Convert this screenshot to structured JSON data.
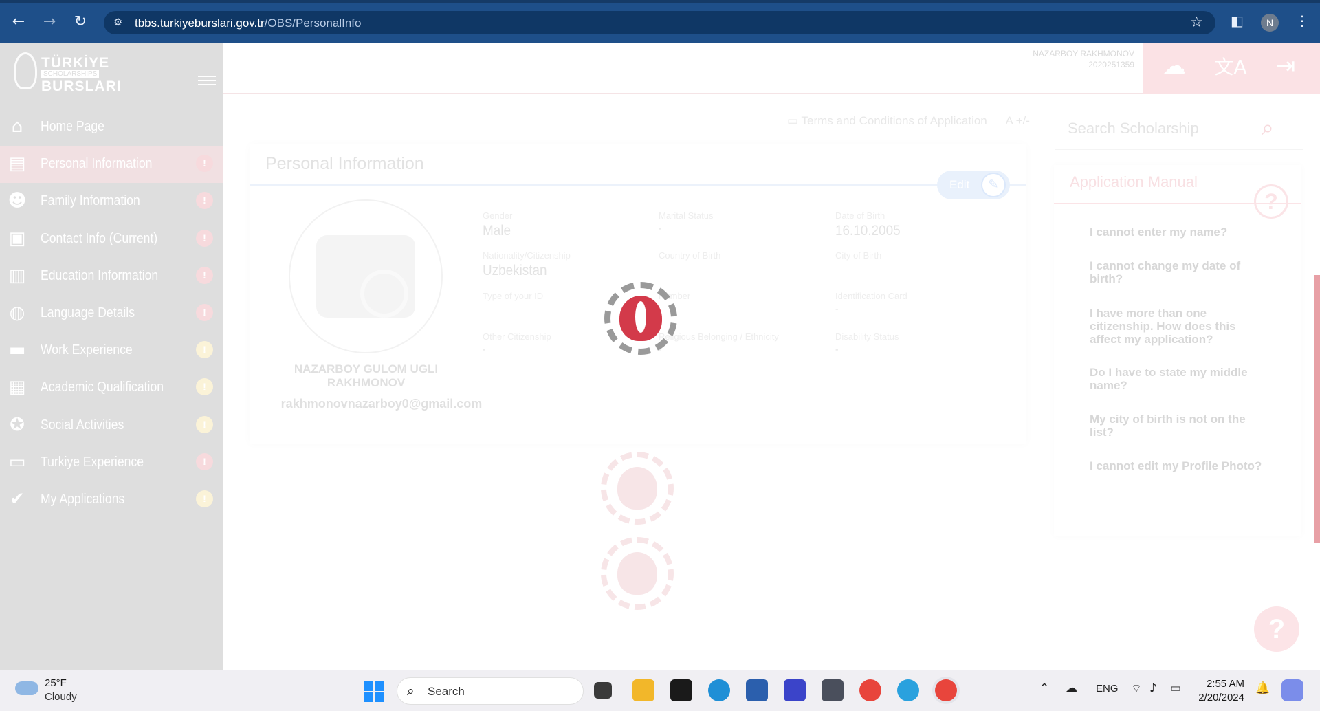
{
  "browser": {
    "url_host": "tbbs.turkiyeburslari.gov.tr",
    "url_path": "/OBS/PersonalInfo",
    "profile_initial": "N"
  },
  "logo": {
    "line1": "TÜRKİYE",
    "line2": "SCHOLARSHIPS",
    "line3": "BURSLARI"
  },
  "sidebar": {
    "items": [
      {
        "label": "Home Page",
        "icon": "home-icon",
        "badge": null
      },
      {
        "label": "Personal Information",
        "icon": "id-card-icon",
        "badge": "!",
        "badge_color": "red",
        "active": true
      },
      {
        "label": "Family Information",
        "icon": "people-icon",
        "badge": "!",
        "badge_color": "red"
      },
      {
        "label": "Contact Info (Current)",
        "icon": "contact-card-icon",
        "badge": "!",
        "badge_color": "red"
      },
      {
        "label": "Education Information",
        "icon": "book-icon",
        "badge": "!",
        "badge_color": "red"
      },
      {
        "label": "Language Details",
        "icon": "globe-icon",
        "badge": "!",
        "badge_color": "red"
      },
      {
        "label": "Work Experience",
        "icon": "briefcase-icon",
        "badge": "!",
        "badge_color": "yellow"
      },
      {
        "label": "Academic Qualification",
        "icon": "certificate-icon",
        "badge": "!",
        "badge_color": "yellow"
      },
      {
        "label": "Social Activities",
        "icon": "medal-icon",
        "badge": "!",
        "badge_color": "yellow"
      },
      {
        "label": "Turkiye Experience",
        "icon": "chat-icon",
        "badge": "!",
        "badge_color": "red"
      },
      {
        "label": "My Applications",
        "icon": "shield-check-icon",
        "badge": "!",
        "badge_color": "yellow"
      }
    ]
  },
  "header": {
    "user_name": "NAZARBOY RAKHMONOV",
    "user_id": "2020251359",
    "icons": [
      "cloud-upload-icon",
      "translate-icon",
      "logout-icon"
    ]
  },
  "toolbar": {
    "terms_label": "Terms and Conditions of Application",
    "font_size_label": "A +/-"
  },
  "search": {
    "placeholder": "Search Scholarship"
  },
  "profile_card": {
    "title": "Personal Information",
    "edit_label": "Edit",
    "full_name": "NAZARBOY GULOM UGLI RAKHMONOV",
    "email": "rakhmonovnazarboy0@gmail.com",
    "fields": [
      {
        "label": "Gender",
        "value": "Male"
      },
      {
        "label": "Marital Status",
        "value": "-"
      },
      {
        "label": "Date of Birth",
        "value": "16.10.2005"
      },
      {
        "label": "Nationality/Citizenship",
        "value": "Uzbekistan"
      },
      {
        "label": "Country of Birth",
        "value": ""
      },
      {
        "label": "City of Birth",
        "value": ""
      },
      {
        "label": "Type of your ID",
        "value": ""
      },
      {
        "label": "Number",
        "value": ""
      },
      {
        "label": "Identification Card",
        "value": "-"
      },
      {
        "label": "Other Citizenship",
        "value": "-"
      },
      {
        "label": "Religious Belonging / Ethnicity",
        "value": "-"
      },
      {
        "label": "Disability Status",
        "value": "-"
      }
    ]
  },
  "manual": {
    "title": "Application Manual",
    "questions": [
      "I cannot enter my name?",
      "I cannot change my date of birth?",
      "I have more than one citizenship. How does this affect my application?",
      "Do I have to state my middle name?",
      "My city of birth is not on the list?",
      "I cannot edit my Profile Photo?"
    ]
  },
  "help_fab": "?",
  "taskbar": {
    "weather_temp": "25°F",
    "weather_desc": "Cloudy",
    "search_placeholder": "Search",
    "lang": "ENG",
    "time": "2:55 AM",
    "date": "2/20/2024"
  },
  "colors": {
    "brand_red": "#d33a4a",
    "chrome_blue": "#1e4f89"
  }
}
